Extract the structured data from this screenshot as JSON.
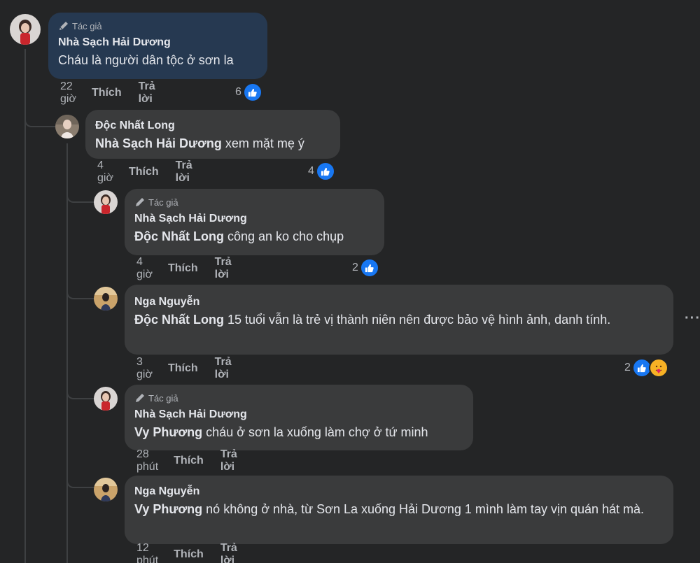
{
  "badge_label": "Tác giả",
  "comments": [
    {
      "author": "Nhà Sạch Hải Dương",
      "author_badge": true,
      "mention": "",
      "text": "Cháu là người dân tộc ở sơn la",
      "time": "22 giờ",
      "like_label": "Thích",
      "reply_label": "Trả lời",
      "reaction_count": "6"
    },
    {
      "author": "Độc Nhất Long",
      "author_badge": false,
      "mention": "Nhà Sạch Hải Dương",
      "text": " xem mặt mẹ ý",
      "time": "4 giờ",
      "like_label": "Thích",
      "reply_label": "Trả lời",
      "reaction_count": "4"
    },
    {
      "author": "Nhà Sạch Hải Dương",
      "author_badge": true,
      "mention": "Độc Nhất Long",
      "text": " công an ko cho chụp",
      "time": "4 giờ",
      "like_label": "Thích",
      "reply_label": "Trả lời",
      "reaction_count": "2"
    },
    {
      "author": "Nga Nguyễn",
      "author_badge": false,
      "mention": "Độc Nhất Long",
      "text": " 15 tuổi vẫn là trẻ vị thành niên nên được bảo vệ hình ảnh, danh tính.",
      "time": "3 giờ",
      "like_label": "Thích",
      "reply_label": "Trả lời",
      "reaction_count": "2",
      "more_label": "···"
    },
    {
      "author": "Nhà Sạch Hải Dương",
      "author_badge": true,
      "mention": "Vy Phương",
      "text": " cháu ở sơn la xuống làm chợ ở tứ minh",
      "time": "28 phút",
      "like_label": "Thích",
      "reply_label": "Trả lời"
    },
    {
      "author": "Nga Nguyễn",
      "author_badge": false,
      "mention": "Vy Phương",
      "text": " nó không ở nhà, từ Sơn La xuống Hải Dương 1 mình làm tay vịn quán hát mà.",
      "time": "12 phút",
      "like_label": "Thích",
      "reply_label": "Trả lời"
    }
  ],
  "colors": {
    "background": "#242526",
    "bubble": "#3a3b3c",
    "bubble_highlight": "#263951",
    "text_primary": "#e4e6eb",
    "text_secondary": "#b0b3b8",
    "like_blue": "#1877f2"
  },
  "icons": {
    "badge": "pencil-icon",
    "like": "like-thumb-icon",
    "care": "care-hug-icon"
  }
}
